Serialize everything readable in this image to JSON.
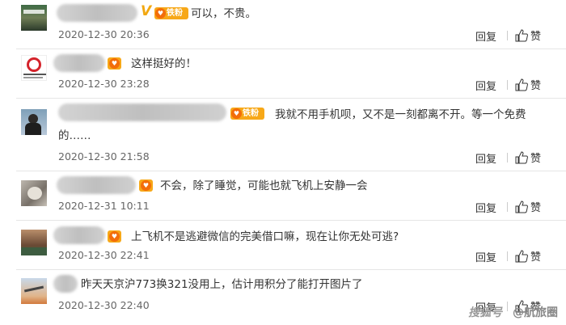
{
  "comments": [
    {
      "text": "可以，不贵。",
      "time": "2020-12-30 20:36",
      "badge": "铁粉",
      "vip": "V"
    },
    {
      "text": "这样挺好的！",
      "time": "2020-12-30 23:28",
      "badge": ""
    },
    {
      "text": "我就不用手机呗，又不是一刻都离不开。等一个免费",
      "text2": "的……",
      "time": "2020-12-30 21:58",
      "badge": "铁粉"
    },
    {
      "text": "不会，除了睡觉，可能也就飞机上安静一会",
      "time": "2020-12-31 10:11",
      "badge": ""
    },
    {
      "text": "上飞机不是逃避微信的完美借口嘛，现在让你无处可逃?",
      "time": "2020-12-30 22:41",
      "badge": ""
    },
    {
      "text": "昨天天京沪773换321没用上，估计用积分了能打开图片了",
      "time": "2020-12-30 22:40",
      "badge": ""
    }
  ],
  "actions": {
    "reply": "回复",
    "like": "赞"
  },
  "watermark": {
    "left": "搜狐号",
    "right": "@航旅圈"
  }
}
